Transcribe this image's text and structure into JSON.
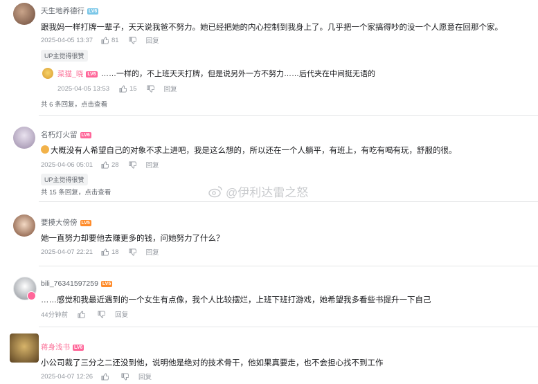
{
  "comments": [
    {
      "username": "天生地养德行",
      "level": "LV6",
      "text": "跟我妈一样打牌一辈子，天天说我爸不努力。她已经把她的内心控制到我身上了。几乎把一个家搞得吵的没一个人愿意在回那个家。",
      "time": "2025-04-05 13:37",
      "likes": "81",
      "reply_label": "回复",
      "badge": "UP主觉得很赞",
      "sub_reply": {
        "username": "菜猫_晓",
        "level": "LV6",
        "text": "……一样的，不上班天天打牌，但是说另外一方不努力……后代夹在中间挺无语的",
        "time": "2025-04-05 13:53",
        "likes": "15",
        "reply_label": "回复"
      },
      "more_replies": "共 6 条回复，点击查看"
    },
    {
      "username": "名朽灯火留",
      "level": "LV6",
      "text": "大概没有人希望自己的对象不求上进吧，我是这么想的，所以还在一个人躺平，有班上，有吃有喝有玩，舒服的很。",
      "time": "2025-04-06 05:01",
      "likes": "28",
      "reply_label": "回复",
      "badge": "UP主觉得很赞",
      "more_replies": "共 15 条回复，点击查看"
    },
    {
      "username": "要摸大傍傍",
      "level": "LV5",
      "text": "她一直努力却要他去赚更多的钱，问她努力了什么？",
      "time": "2025-04-07 22:21",
      "likes": "18",
      "reply_label": "回复"
    },
    {
      "username": "bili_76341597259",
      "level": "LV5",
      "text": "……感觉和我最近遇到的一个女生有点像，我个人比较摆烂，上班下班打游戏，她希望我多看些书提升一下自己",
      "time": "44分钟前",
      "likes": "",
      "reply_label": "回复"
    },
    {
      "username": "蒋身浅书",
      "level": "LV6",
      "text": "小公司裁了三分之二还没到他，说明他是绝对的技术骨干，他如果真要走，也不会担心找不到工作",
      "time": "2025-04-07 12:26",
      "likes": "",
      "reply_label": "回复"
    }
  ],
  "watermark": "@伊利达雷之怒",
  "colors": {
    "lv6": "#ff6699",
    "lv5": "#ff8c2b",
    "vip_name": "#fb7299",
    "meta": "#9499a0"
  }
}
